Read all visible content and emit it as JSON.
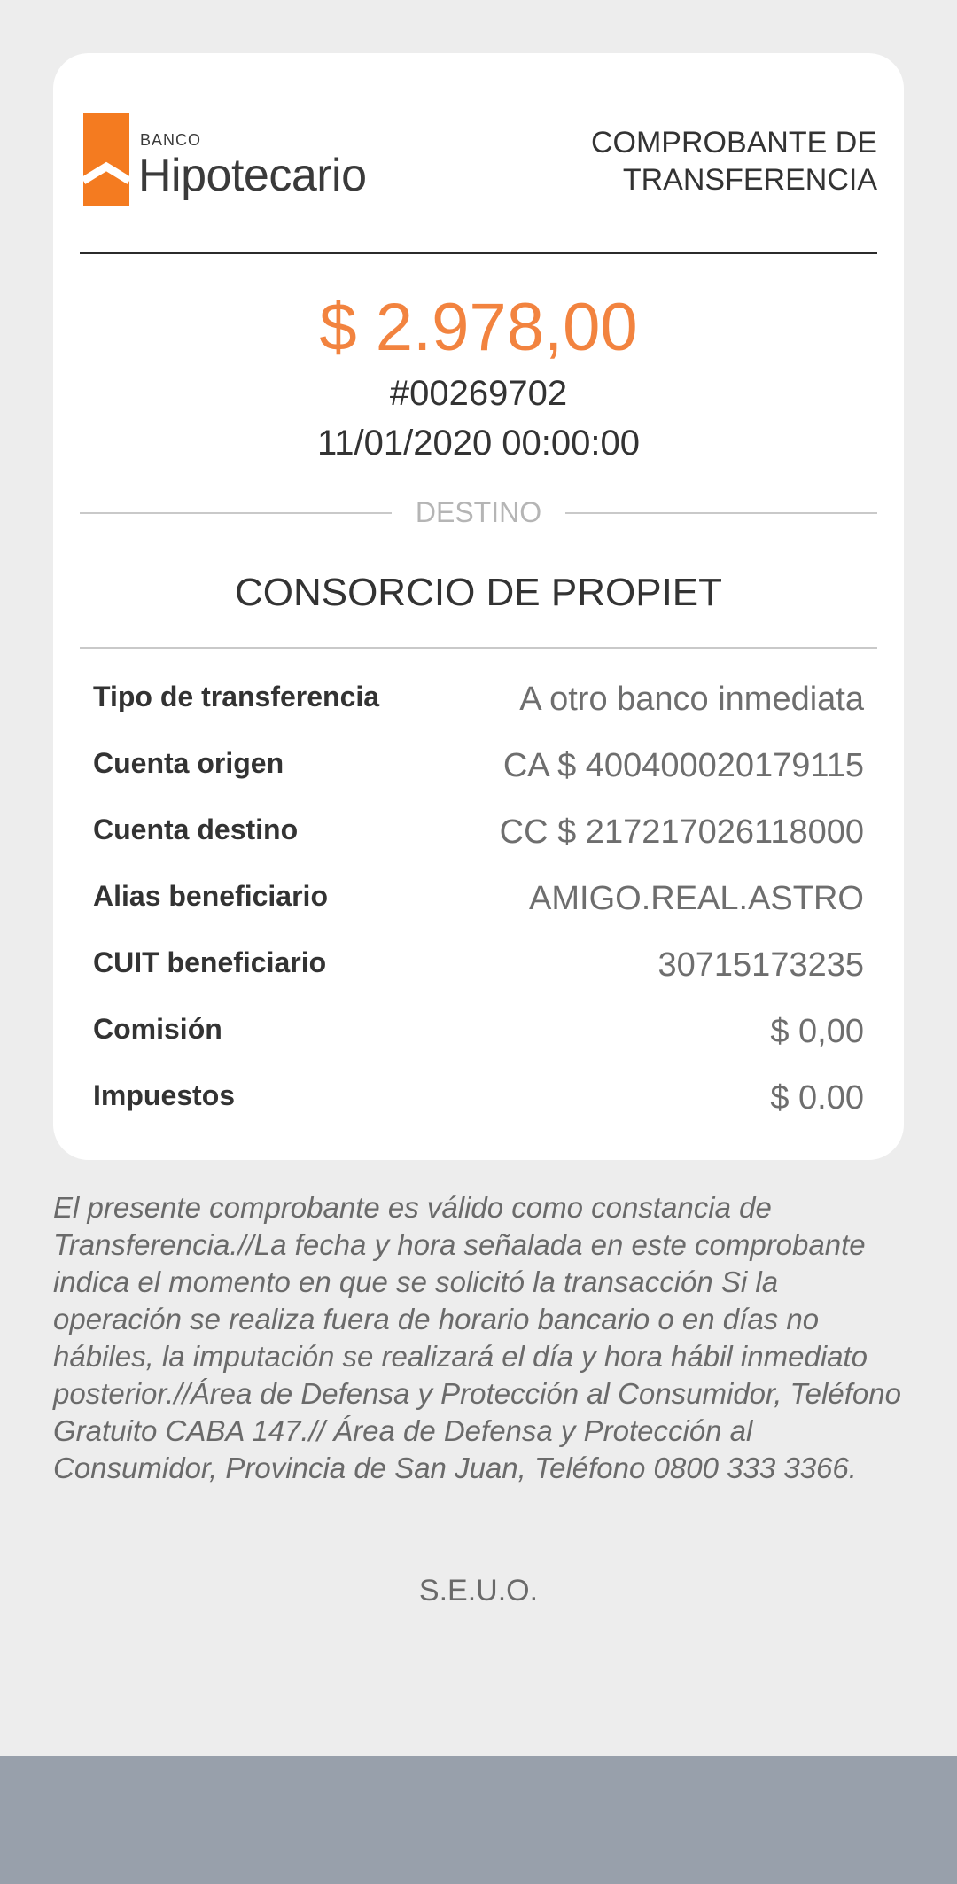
{
  "header": {
    "logo_small": "BANCO",
    "logo_name": "Hipotecario",
    "title": "COMPROBANTE DE TRANSFERENCIA"
  },
  "summary": {
    "amount": "$ 2.978,00",
    "number": "#00269702",
    "date": "11/01/2020 00:00:00"
  },
  "destination": {
    "label": "DESTINO",
    "name": "CONSORCIO DE PROPIET"
  },
  "details": [
    {
      "label": "Tipo de transferencia",
      "value": "A otro banco inmediata"
    },
    {
      "label": "Cuenta origen",
      "value": "CA $ 400400020179115"
    },
    {
      "label": "Cuenta destino",
      "value": "CC $ 217217026118000"
    },
    {
      "label": "Alias beneficiario",
      "value": "AMIGO.REAL.ASTRO"
    },
    {
      "label": "CUIT beneficiario",
      "value": "30715173235"
    },
    {
      "label": "Comisión",
      "value": "$ 0,00"
    },
    {
      "label": "Impuestos",
      "value": "$ 0.00"
    }
  ],
  "legal": "El presente comprobante es válido como constancia de Transferencia.//La fecha y hora señalada en este comprobante indica el momento en que se solicitó la transacción Si la operación se realiza fuera de horario bancario o en días no hábiles, la imputación se realizará el día y hora hábil inmediato posterior.//Área de Defensa y Protección al Consumidor, Teléfono Gratuito CABA 147.// Área de Defensa y Protección al Consumidor, Provincia de San Juan, Teléfono 0800 333 3366.",
  "footer": {
    "seuo": "S.E.U.O."
  },
  "colors": {
    "accent": "#f2833f",
    "bottom_bar": "#98a0ab",
    "background": "#ededed"
  },
  "icons": {
    "logo": "bank-logo-icon"
  }
}
